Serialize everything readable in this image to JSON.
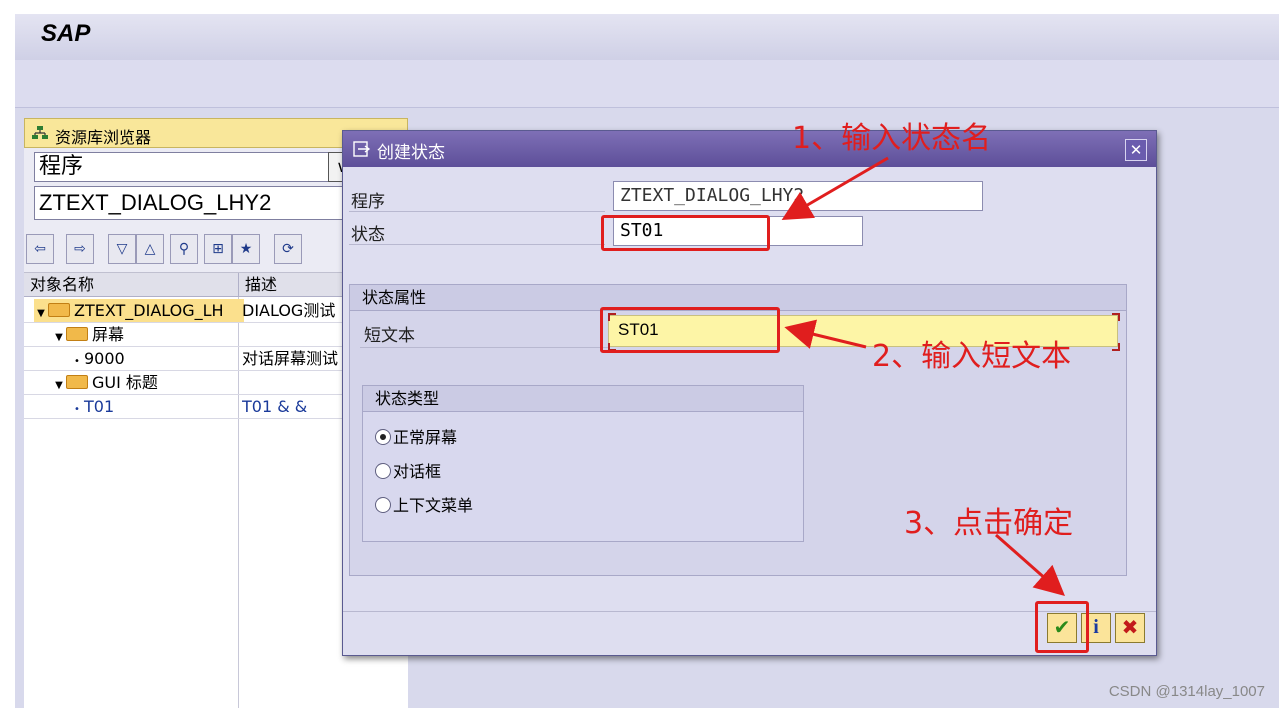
{
  "sap": {
    "logo": "SAP"
  },
  "repo": {
    "header_label": "资源库浏览器",
    "object_type": "程序",
    "object_name": "ZTEXT_DIALOG_LHY2",
    "tree": {
      "col_object": "对象名称",
      "col_desc": "描述",
      "rows": [
        {
          "name": "ZTEXT_DIALOG_LH",
          "desc": "DIALOG测试"
        },
        {
          "name": "屏幕",
          "desc": ""
        },
        {
          "name": "9000",
          "desc": "对话屏幕测试"
        },
        {
          "name": "GUI 标题",
          "desc": ""
        },
        {
          "name": "T01",
          "desc": "T01 & &"
        }
      ]
    }
  },
  "dialog": {
    "title": "创建状态",
    "program_label": "程序",
    "program_value": "ZTEXT_DIALOG_LHY2",
    "status_label": "状态",
    "status_value": "ST01",
    "attr_group_title": "状态属性",
    "short_text_label": "短文本",
    "short_text_value": "ST01",
    "type_group_title": "状态类型",
    "type_options": [
      "正常屏幕",
      "对话框",
      "上下文菜单"
    ],
    "selected_type": "正常屏幕"
  },
  "annotations": {
    "step1": "1、输入状态名",
    "step2": "2、输入短文本",
    "step3": "3、点击确定"
  },
  "watermark": "CSDN @1314lay_1007",
  "colors": {
    "annotation": "#e01e1e",
    "dialog_title": "#5d4f99"
  }
}
